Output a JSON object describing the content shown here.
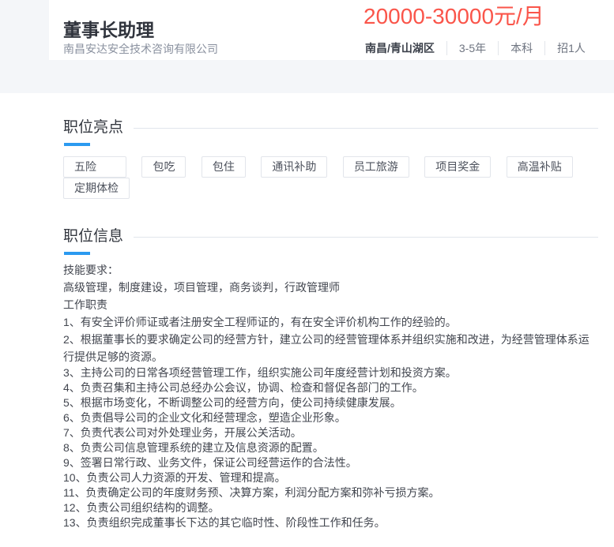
{
  "header": {
    "job_title": "董事长助理",
    "salary": "20000-30000元/月",
    "company": "南昌安达安全技术咨询有限公司",
    "location": "南昌/青山湖区",
    "experience": "3-5年",
    "education": "本科",
    "headcount": "招1人"
  },
  "highlights": {
    "title": "职位亮点",
    "tags": [
      "五险",
      "包吃",
      "包住",
      "通讯补助",
      "员工旅游",
      "项目奖金",
      "高温补贴",
      "定期体检"
    ]
  },
  "info": {
    "title": "职位信息",
    "lines": [
      "技能要求：",
      "高级管理，制度建设，项目管理，商务谈判，行政管理师",
      "工作职责",
      "1、有安全评价师证或者注册安全工程师证的，有在安全评价机构工作的经验的。",
      "2、根据董事长的要求确定公司的经营方针，建立公司的经营管理体系并组织实施和改进，为经营管理体系运行提供足够的资源。",
      "3、主持公司的日常各项经营管理工作，组织实施公司年度经营计划和投资方案。",
      "4、负责召集和主持公司总经办公会议，协调、检查和督促各部门的工作。",
      "5、根据市场变化，不断调整公司的经营方向，使公司持续健康发展。",
      "6、负责倡导公司的企业文化和经营理念，塑造企业形象。",
      "7、负责代表公司对外处理业务，开展公关活动。",
      "8、负责公司信息管理系统的建立及信息资源的配置。",
      "9、签署日常行政、业务文件，保证公司经营运作的合法性。",
      "10、负责公司人力资源的开发、管理和提高。",
      "11、负责确定公司的年度财务预、决算方案，利润分配方案和弥补亏损方案。",
      "12、负责公司组织结构的调整。",
      "13、负责组织完成董事长下达的其它临时性、阶段性工作和任务。"
    ]
  },
  "colors": {
    "salary_red": "#fa554a",
    "accent_blue": "#2b9af0",
    "page_gray": "#f4f6f9"
  }
}
